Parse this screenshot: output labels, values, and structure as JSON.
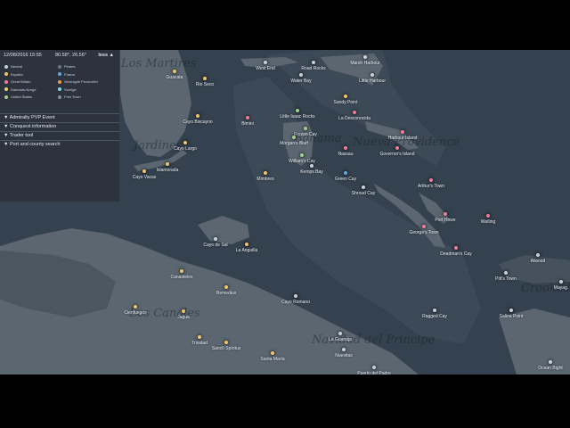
{
  "panel": {
    "date": "12/08/2016 15:55",
    "coords": "80.58°, 26.56°",
    "toggle": "less ▲",
    "legend": [
      {
        "label": "Neutral",
        "color": "#c8d0d8"
      },
      {
        "label": "Pirates",
        "color": "#6e7884"
      },
      {
        "label": "España",
        "color": "#f2c46a"
      },
      {
        "label": "France",
        "color": "#5fa8e8"
      },
      {
        "label": "Great Britain",
        "color": "#ef7d9a"
      },
      {
        "label": "Verenigde Provinciën",
        "color": "#f0984a"
      },
      {
        "label": "Danmark-Norge",
        "color": "#e8d070"
      },
      {
        "label": "Sverige",
        "color": "#7fd7e8"
      },
      {
        "label": "United States",
        "color": "#9fd08f"
      },
      {
        "label": "Free Town",
        "color": "#7f8ea0"
      }
    ],
    "sections": [
      "▼ Admiralty PVP Event",
      "▼ Conquest information",
      "▼ Trader tool",
      "▼ Port and county search"
    ]
  },
  "regions": [
    "Los Martires",
    "Nueva Providence",
    "Bahama",
    "Jardines",
    "Los Canales",
    "Navidad del Principe",
    "Crooked"
  ],
  "ports": [
    {
      "name": "Guacata",
      "color": "#f2c46a"
    },
    {
      "name": "Rio Seco",
      "color": "#f2c46a"
    },
    {
      "name": "West End",
      "color": "#c8d0d8"
    },
    {
      "name": "Road Rocks",
      "color": "#c8d0d8"
    },
    {
      "name": "Marsh Harbour",
      "color": "#c8d0d8"
    },
    {
      "name": "Water Bay",
      "color": "#c8d0d8"
    },
    {
      "name": "Little Harbour",
      "color": "#c8d0d8"
    },
    {
      "name": "Sandy Point",
      "color": "#f2c46a"
    },
    {
      "name": "Little Isaac Rocks",
      "color": "#9fd08f"
    },
    {
      "name": "La Desconocida",
      "color": "#ef7d9a"
    },
    {
      "name": "Cayo Biscayno",
      "color": "#f2c46a"
    },
    {
      "name": "Bimini",
      "color": "#ef7d9a"
    },
    {
      "name": "Frozen Cay",
      "color": "#9fd08f"
    },
    {
      "name": "Harbour Island",
      "color": "#ef7d9a"
    },
    {
      "name": "Cayo Largo",
      "color": "#f2c46a"
    },
    {
      "name": "Morgan's Bluff",
      "color": "#9fd08f"
    },
    {
      "name": "Nassau",
      "color": "#ef7d9a"
    },
    {
      "name": "Governor's Island",
      "color": "#ef7d9a"
    },
    {
      "name": "Islamorada",
      "color": "#f2c46a"
    },
    {
      "name": "William's Cay",
      "color": "#9fd08f"
    },
    {
      "name": "Cayo Vacas",
      "color": "#f2c46a"
    },
    {
      "name": "Mimbres",
      "color": "#f2c46a"
    },
    {
      "name": "Kemps Bay",
      "color": "#c8d0d8"
    },
    {
      "name": "Green Cay",
      "color": "#5fa8e8"
    },
    {
      "name": "Arthur's Town",
      "color": "#ef7d9a"
    },
    {
      "name": "Shroud Cay",
      "color": "#c8d0d8"
    },
    {
      "name": "Port Howe",
      "color": "#ef7d9a"
    },
    {
      "name": "Watling",
      "color": "#ef7d9a"
    },
    {
      "name": "George's Town",
      "color": "#ef7d9a"
    },
    {
      "name": "Cayo de Sal",
      "color": "#c8d0d8"
    },
    {
      "name": "La Anguilla",
      "color": "#f2c46a"
    },
    {
      "name": "Deadman's Cay",
      "color": "#ef7d9a"
    },
    {
      "name": "Atwood",
      "color": "#c8d0d8"
    },
    {
      "name": "Canasteles",
      "color": "#f2c46a"
    },
    {
      "name": "Pitt's Town",
      "color": "#c8d0d8"
    },
    {
      "name": "Remedios",
      "color": "#f2c46a"
    },
    {
      "name": "Mayag.",
      "color": "#c8d0d8"
    },
    {
      "name": "Cayo Romano",
      "color": "#c8d0d8"
    },
    {
      "name": "Ragged Cay",
      "color": "#c8d0d8"
    },
    {
      "name": "Salina Point",
      "color": "#c8d0d8"
    },
    {
      "name": "Cienfuegos",
      "color": "#f2c46a"
    },
    {
      "name": "Jagua",
      "color": "#f2c46a"
    },
    {
      "name": "Trinidad",
      "color": "#f2c46a"
    },
    {
      "name": "La Guanaja",
      "color": "#c8d0d8"
    },
    {
      "name": "Sanctí Spíritus",
      "color": "#f2c46a"
    },
    {
      "name": "Nuevitas",
      "color": "#c8d0d8"
    },
    {
      "name": "Santa María",
      "color": "#f2c46a"
    },
    {
      "name": "Puerto del Padre",
      "color": "#c8d0d8"
    },
    {
      "name": "Ocean Bight",
      "color": "#c8d0d8"
    }
  ]
}
